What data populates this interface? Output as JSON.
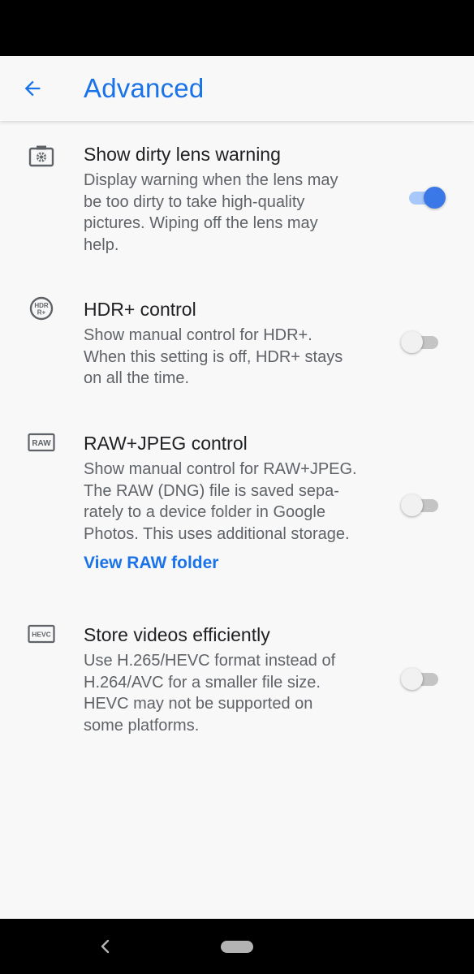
{
  "header": {
    "title": "Advanced",
    "back_icon": "arrow-back-icon",
    "accent_color": "#1a73e8"
  },
  "settings": [
    {
      "icon": "dirty-lens-icon",
      "title": "Show dirty lens warning",
      "description_lines": [
        "Display warning when the lens may",
        "be too dirty to take high-quality",
        "pictures. Wiping off the lens may",
        "help."
      ],
      "enabled": true
    },
    {
      "icon": "hdr-plus-icon",
      "icon_text": "HDR+",
      "title": "HDR+ control",
      "description_lines": [
        "Show manual control for HDR+.",
        "When this setting is off, HDR+ stays",
        "on all the time."
      ],
      "enabled": false
    },
    {
      "icon": "raw-icon",
      "icon_text": "RAW",
      "title": "RAW+JPEG control",
      "description_lines": [
        "Show manual control for RAW+JPEG.",
        "The RAW (DNG) file is saved sepa-",
        "rately to a device folder in Google",
        "Photos. This uses additional storage."
      ],
      "link": "View RAW folder",
      "enabled": false
    },
    {
      "icon": "hevc-icon",
      "icon_text": "HEVC",
      "title": "Store videos efficiently",
      "description_lines": [
        "Use H.265/HEVC format instead of",
        "H.264/AVC for a smaller file size.",
        "HEVC may not be supported on",
        "some platforms."
      ],
      "enabled": false
    }
  ],
  "nav": {
    "back_icon": "nav-back-icon",
    "home_icon": "nav-home-pill-icon"
  }
}
